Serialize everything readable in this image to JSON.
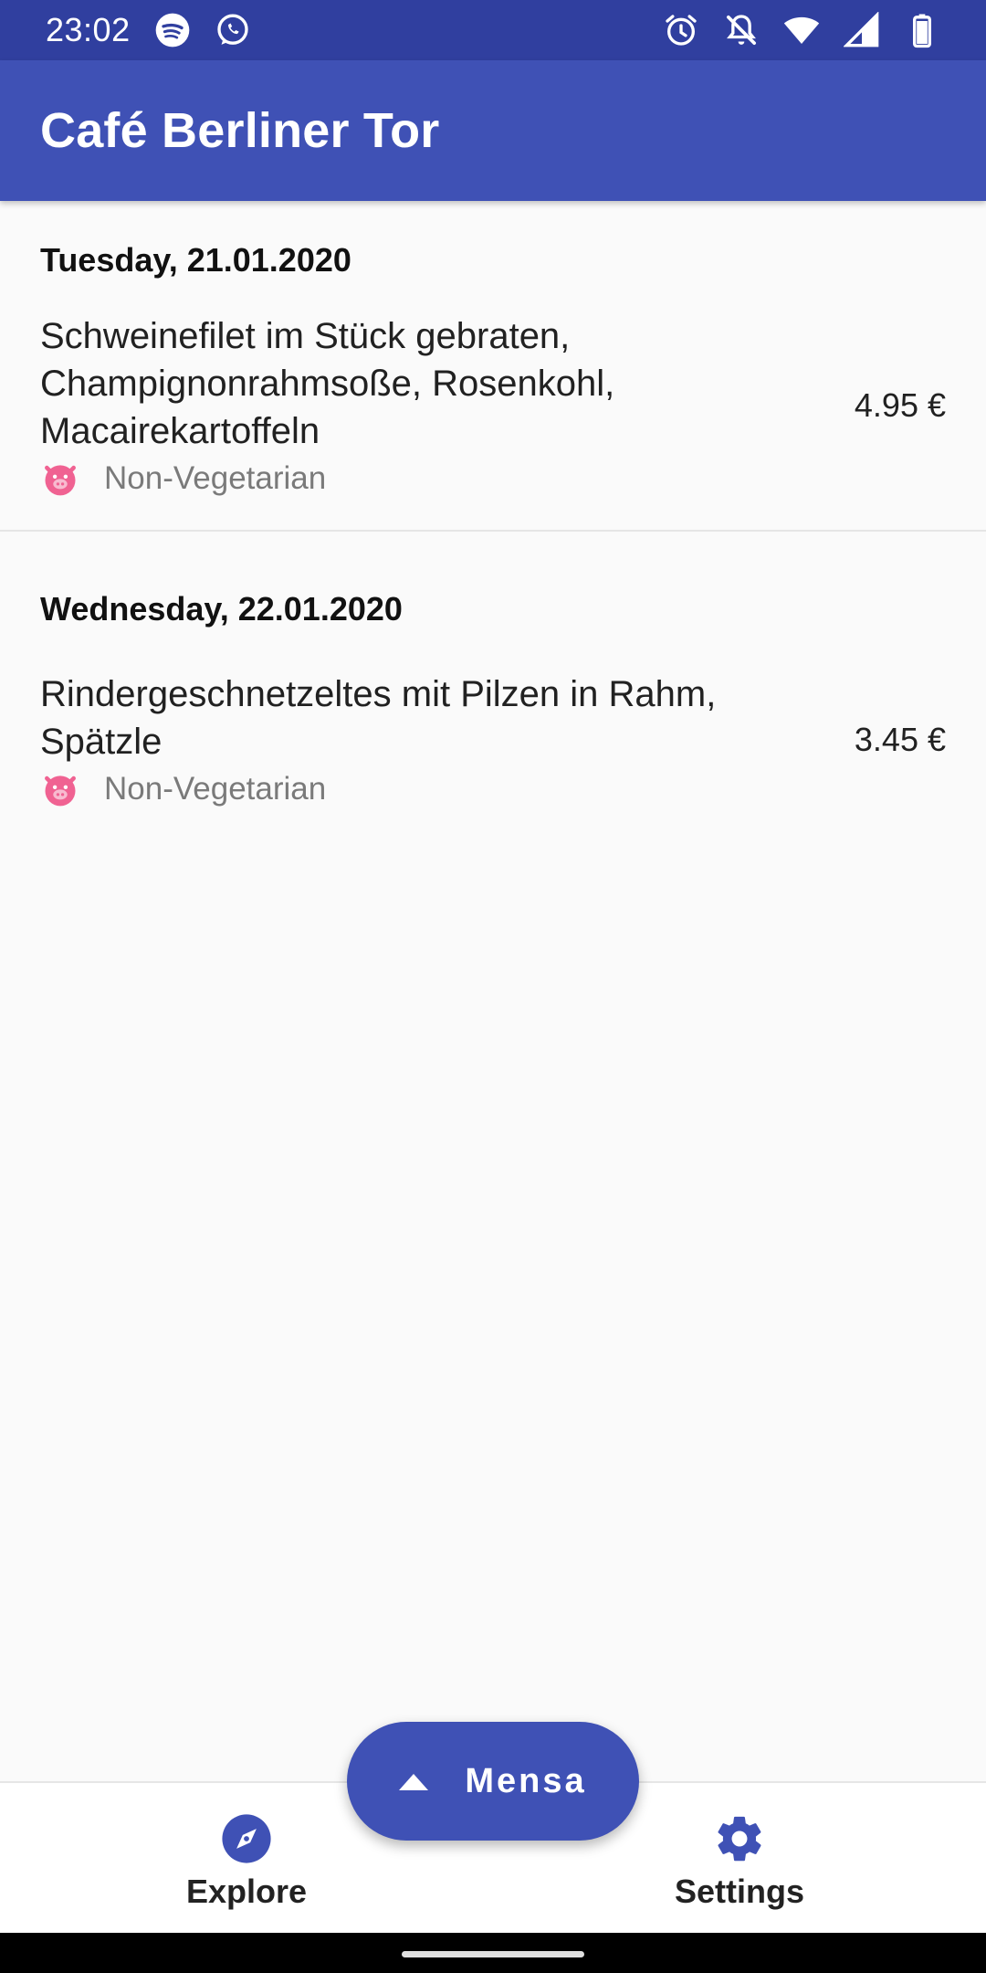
{
  "status_bar": {
    "time": "23:02",
    "left_icons": [
      "spotify-icon",
      "whatsapp-icon"
    ],
    "right_icons": [
      "alarm-icon",
      "notifications-off-icon",
      "wifi-icon",
      "signal-icon",
      "battery-icon"
    ]
  },
  "app_bar": {
    "title": "Café Berliner Tor"
  },
  "days": [
    {
      "date": "Tuesday, 21.01.2020",
      "meals": [
        {
          "name": "Schweinefilet im Stück gebraten, Champignonrahmsoße, Rosenkohl, Macairekartoffeln",
          "tag": "Non-Vegetarian",
          "price": "4.95 €"
        }
      ]
    },
    {
      "date": "Wednesday, 22.01.2020",
      "meals": [
        {
          "name": "Rindergeschnetzeltes mit Pilzen in Rahm, Spätzle",
          "tag": "Non-Vegetarian",
          "price": "3.45 €"
        }
      ]
    }
  ],
  "fab": {
    "label": "Mensa",
    "icon": "arrow-up-icon"
  },
  "bottom_nav": {
    "items": [
      {
        "label": "Explore",
        "icon": "compass-icon"
      },
      {
        "label": "Settings",
        "icon": "gear-icon"
      }
    ]
  },
  "colors": {
    "primary": "#3f51b5",
    "primary_dark": "#303f9f",
    "pig_icon": "#f06292",
    "secondary_text": "#7a7a7a"
  }
}
